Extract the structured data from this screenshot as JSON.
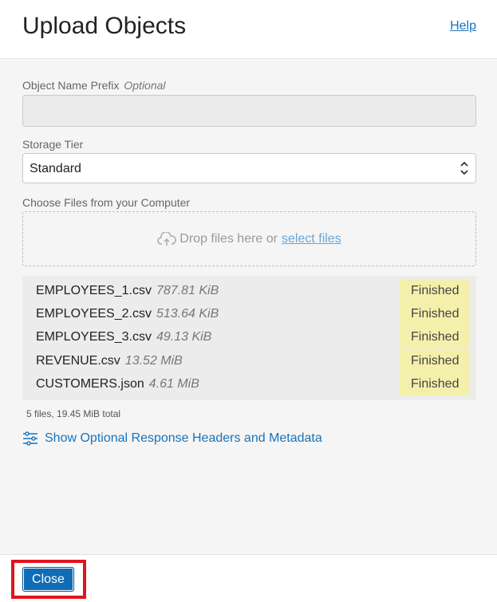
{
  "header": {
    "title": "Upload Objects",
    "help_label": "Help"
  },
  "form": {
    "prefix_label": "Object Name Prefix",
    "prefix_optional": "Optional",
    "prefix_value": "",
    "tier_label": "Storage Tier",
    "tier_value": "Standard",
    "choose_label": "Choose Files from your Computer",
    "drop_text": "Drop files here or",
    "select_files": "select files"
  },
  "files": [
    {
      "name": "EMPLOYEES_1.csv",
      "size": "787.81 KiB",
      "status": "Finished"
    },
    {
      "name": "EMPLOYEES_2.csv",
      "size": "513.64 KiB",
      "status": "Finished"
    },
    {
      "name": "EMPLOYEES_3.csv",
      "size": "49.13 KiB",
      "status": "Finished"
    },
    {
      "name": "REVENUE.csv",
      "size": "13.52 MiB",
      "status": "Finished"
    },
    {
      "name": "CUSTOMERS.json",
      "size": "4.61 MiB",
      "status": "Finished"
    }
  ],
  "summary": "5 files, 19.45 MiB total",
  "show_headers_label": "Show Optional Response Headers and Metadata",
  "footer": {
    "close_label": "Close"
  },
  "icons": {
    "cloud": "cloud-upload-icon",
    "sliders": "sliders-icon",
    "select": "up-down-chevron-icon"
  },
  "colors": {
    "link": "#1a73b8",
    "status_bg": "#f4f0ac",
    "primary": "#0f6cb5",
    "highlight": "#e0141e"
  }
}
